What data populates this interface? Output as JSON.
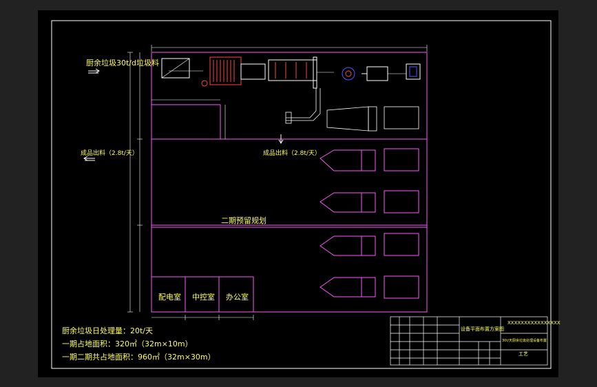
{
  "labels": {
    "inflow": "厨余垃圾30t/d垃圾料",
    "outflow_left": "成品出料（2.8t/天）",
    "outflow_center": "成品出料（2.8t/天）",
    "phase2": "二期预留规划",
    "room_power": "配电室",
    "room_control": "中控室",
    "room_office": "办公室"
  },
  "notes": [
    "厨余垃圾日处理量：20t/天",
    "一期占地面积：320㎡（32m×10m）",
    "一期二期共占地面积：960㎡（32m×30m）"
  ],
  "title_block": {
    "drawing_title": "设备平面布置方案图",
    "project": "30t/天厨余垃圾处理设备布置",
    "code": "XXXXXXXXXXXXXXXX",
    "dept": "工艺"
  },
  "colors": {
    "frame": "#ffffff",
    "building": "#ff55ff",
    "dims": "#ffffff",
    "text": "#ffff55",
    "equipment_red": "#ff4444",
    "equipment_blue": "#5555ff",
    "equipment_cyan": "#55ffff"
  }
}
